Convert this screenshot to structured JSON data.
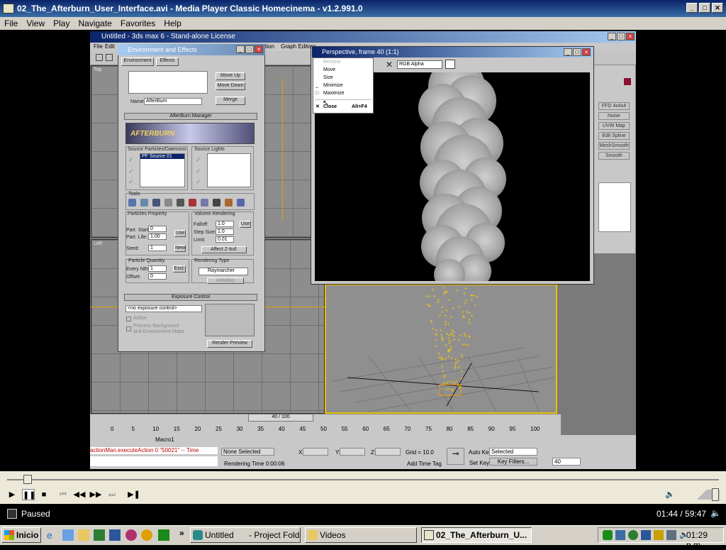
{
  "window": {
    "title": "02_The_Afterburn_User_Interface.avi - Media Player Classic Homecinema - v1.2.991.0",
    "menu": [
      "File",
      "View",
      "Play",
      "Navigate",
      "Favorites",
      "Help"
    ]
  },
  "max": {
    "title": "Untitled - 3ds max 6 - Stand-alone License",
    "menu_file": "File",
    "menu_edit": "Edit",
    "menu_tion": "tion",
    "menu_graph": "Graph Editors",
    "vp_top": "Top",
    "vp_left": "Left",
    "cmd_buttons": [
      "FFD 4x4x4",
      "Noise",
      "UVW Map",
      "Edit Spline",
      "MeshSmooth",
      "Smooth"
    ],
    "time_slider": "40 / 100",
    "ticks": [
      "0",
      "5",
      "10",
      "15",
      "20",
      "25",
      "30",
      "35",
      "40",
      "45",
      "50",
      "55",
      "60",
      "65",
      "70",
      "75",
      "80",
      "85",
      "90",
      "95",
      "100"
    ],
    "macro": "Macro1",
    "script": "actionMan.executeAction 0 \"50021\"  -- Time",
    "none_selected": "None Selected",
    "rendering_time": "Rendering Time  0:00:06",
    "x": "X:",
    "y": "Y:",
    "z": "Z:",
    "grid": "Grid = 10.0",
    "add_time_tag": "Add Time Tag",
    "auto_key": "Auto Key",
    "selected": "Selected",
    "set_key": "Set Key",
    "key_filters": "Key Filters...",
    "frame": "40"
  },
  "env": {
    "title": "Environment and Effects",
    "tab_env": "Environment",
    "tab_effects": "Effects",
    "move_up": "Move Up",
    "move_down": "Move Down",
    "name_label": "Name:",
    "name_value": "AfterBurn",
    "merge": "Merge",
    "manager": "AfterBurn Manager",
    "logo": "AFTERBURN",
    "src_particles": "Source Particles/Daemons",
    "src_particle_item": "PF Source 01",
    "src_lights": "Source Lights",
    "tools": "Tools",
    "particles_property": "Particles Property",
    "part_start": "Part. Start:",
    "part_start_v": "0",
    "part_life": "Part. Life:",
    "part_life_v": "1.00",
    "use": "Use",
    "seed": "Seed:",
    "seed_v": "1",
    "new": "New",
    "volume_rendering": "Volume Rendering",
    "falloff": "Falloff:",
    "falloff_v": "1.0",
    "step_size": "Step Size:",
    "step_size_v": "1.0",
    "limit": "Limit:",
    "limit_v": "0.01",
    "affect_z": "Affect Z-buf.",
    "particle_quantity": "Particle Quantity",
    "every_nth": "Every Nth:",
    "every_nth_v": "1",
    "excl": "Excl.",
    "offset": "Offset:",
    "offset_v": "0",
    "rendering_type": "Rendering Type",
    "raymarcher": "Raymarcher",
    "antialias": "Antialias",
    "exposure_control": "Exposure Control",
    "no_exposure": "<no exposure control>",
    "active": "Active",
    "process_bg": "Process Background",
    "and_env_maps": "and Environment Maps",
    "render_preview": "Render Preview"
  },
  "persp": {
    "title": "Perspective, frame 40 (1:1)",
    "channel": "RGB Alpha",
    "sysmenu": {
      "restore": "Restore",
      "move": "Move",
      "size": "Size",
      "minimize": "Minimize",
      "maximize": "Maximize",
      "close": "Close",
      "close_shortcut": "Alt+F4"
    }
  },
  "player": {
    "status": "Paused",
    "time": "01:44 / 59:47",
    "position": 0.029
  },
  "taskbar": {
    "start": "Inicio",
    "items": [
      "Untitled",
      "- Project Fold...",
      "Videos",
      "02_The_Afterburn_U..."
    ],
    "clock": "01:29 p.m.",
    "more": "»"
  },
  "colors": {
    "title_blue": "#0a246a",
    "face": "#d4d0c8",
    "particle": "#ffcc00"
  }
}
